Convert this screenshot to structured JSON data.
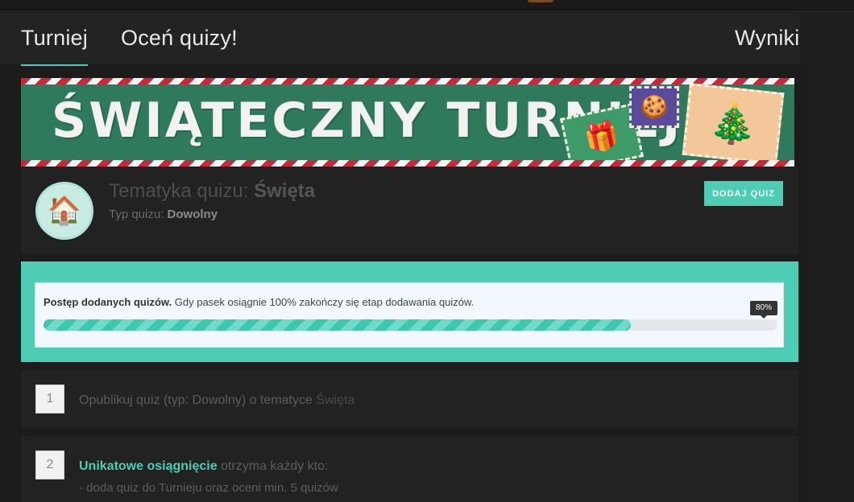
{
  "nav": {
    "tabs": [
      {
        "label": "Turniej",
        "active": true
      },
      {
        "label": "Oceń quizy!",
        "active": false
      },
      {
        "label": "Wyniki",
        "active": false
      }
    ]
  },
  "banner": {
    "title": "ŚWIĄTECZNY TURNIEJ",
    "stripe_colors": [
      "#c8283a",
      "#f4f4f4"
    ],
    "background": "#2f7a5c"
  },
  "quiz": {
    "topic_prefix": "Tematyka quizu:",
    "topic": "Święta",
    "type_prefix": "Typ quizu:",
    "type": "Dowolny",
    "avatar_icon": "gingerbread-house-icon",
    "add_button": "DODAJ QUIZ"
  },
  "progress": {
    "label_bold": "Postęp dodanych quizów.",
    "label_rest": "Gdy pasek osiągnie 100% zakończy się etap dodawania quizów.",
    "percent": 80,
    "percent_label": "80%"
  },
  "steps": [
    {
      "number": "1",
      "text": "Opublikuj quiz (typ: Dowolny) o tematyce",
      "highlight": "Święta"
    },
    {
      "number": "2",
      "bold": "Unikatowe osiągnięcie",
      "text": "otrzyma każdy kto:",
      "line2": "- doda quiz do Turnieju oraz oceni min. 5 quizów"
    }
  ],
  "colors": {
    "accent": "#4ecdb4",
    "background": "#1c1c1c",
    "card": "#222222"
  }
}
